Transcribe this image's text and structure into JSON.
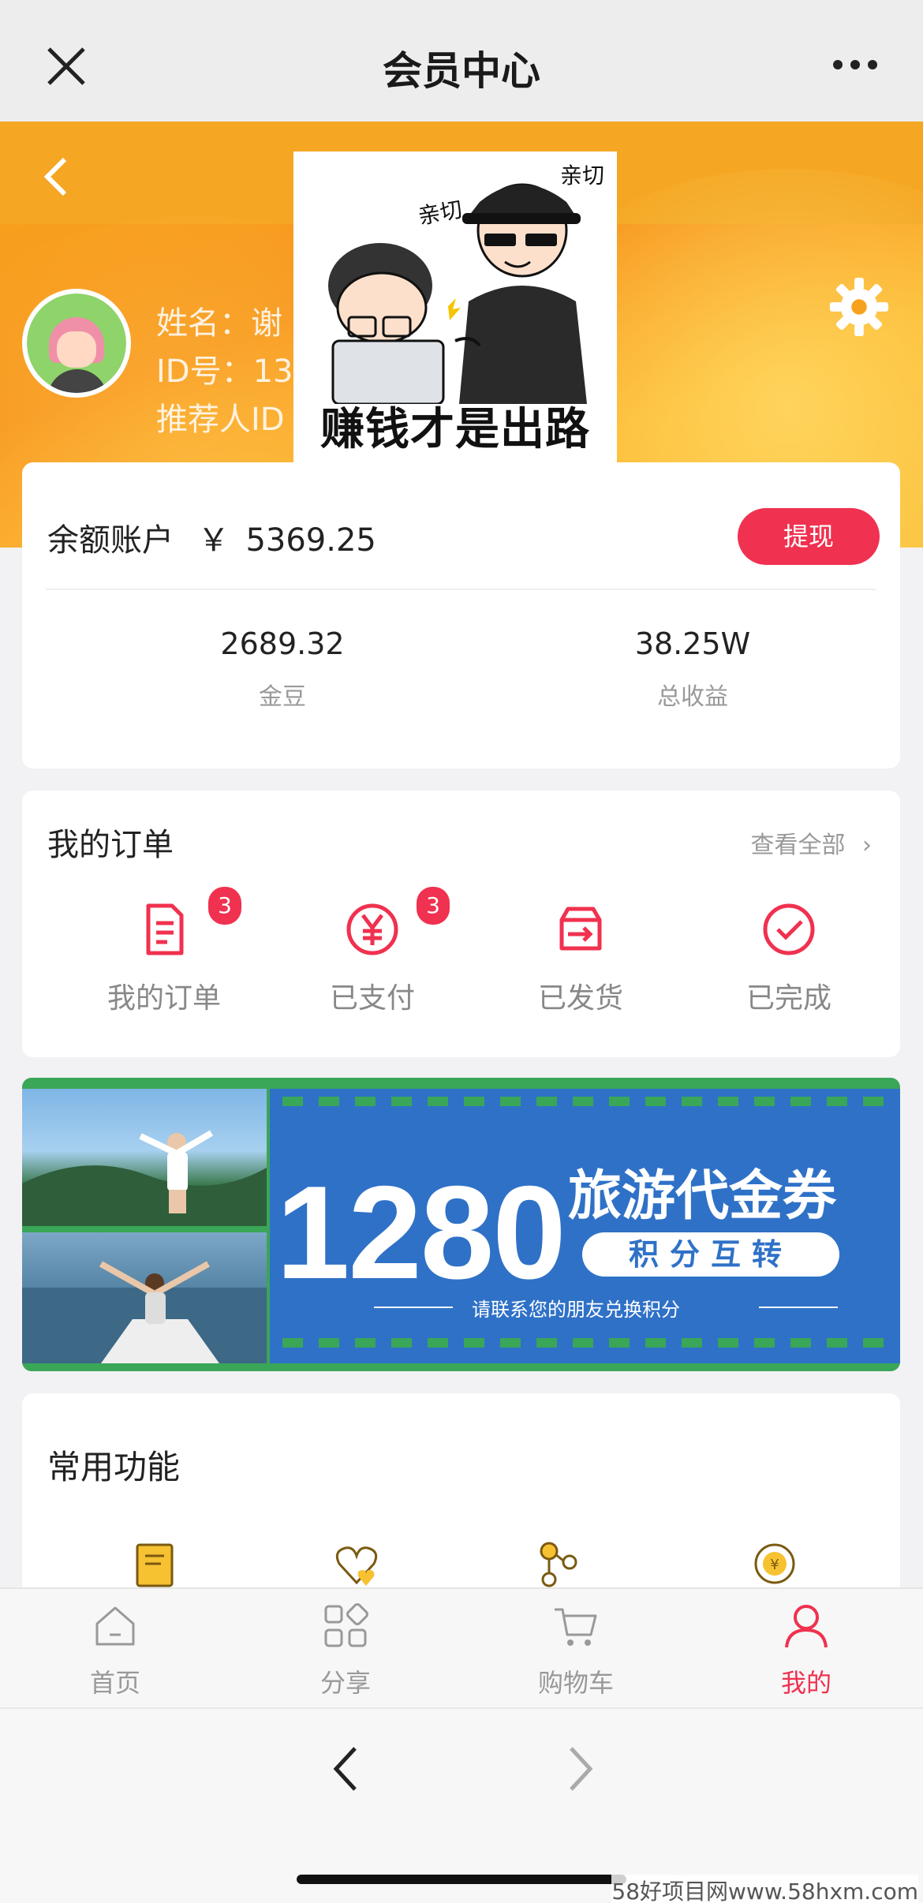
{
  "topbar": {
    "title": "会员中心"
  },
  "user": {
    "name_line": "姓名：谢",
    "id_line": "ID号：13",
    "referrer_line": "推荐人ID"
  },
  "meme": {
    "caption": "赚钱才是出路",
    "label_a": "亲切",
    "label_b": "亲切"
  },
  "balance": {
    "label": "余额账户",
    "currency": "￥",
    "amount": "5369.25",
    "withdraw_label": "提现",
    "stats": [
      {
        "value": "2689.32",
        "label": "金豆"
      },
      {
        "value": "38.25W",
        "label": "总收益"
      }
    ]
  },
  "orders": {
    "title": "我的订单",
    "view_all": "查看全部",
    "items": [
      {
        "label": "我的订单",
        "badge": "3",
        "icon": "order-list-icon"
      },
      {
        "label": "已支付",
        "badge": "3",
        "icon": "yen-icon"
      },
      {
        "label": "已发货",
        "badge": "",
        "icon": "shipped-box-icon"
      },
      {
        "label": "已完成",
        "badge": "",
        "icon": "check-circle-icon"
      }
    ]
  },
  "banner": {
    "number": "1280",
    "title": "旅游代金券",
    "pill": "积分互转",
    "subtitle": "请联系您的朋友兑换积分"
  },
  "common": {
    "title": "常用功能"
  },
  "tabbar": {
    "items": [
      {
        "label": "首页",
        "icon": "home-icon",
        "active": false
      },
      {
        "label": "分享",
        "icon": "grid-icon",
        "active": false
      },
      {
        "label": "购物车",
        "icon": "cart-icon",
        "active": false
      },
      {
        "label": "我的",
        "icon": "person-icon",
        "active": true
      }
    ]
  },
  "watermark": "58好项目网www.58hxm.com",
  "colors": {
    "accent": "#f0314f",
    "header_orange": "#f7941d",
    "banner_blue": "#2f71c7",
    "banner_green": "#3aa657"
  }
}
